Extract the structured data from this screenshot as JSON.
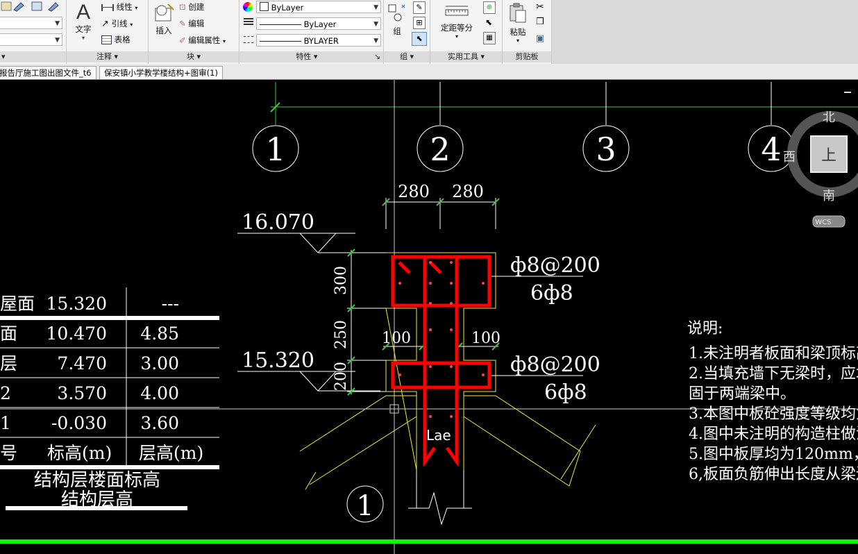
{
  "ribbon": {
    "annotation_panel": {
      "title": "注释",
      "text_btn": "文字",
      "linear_btn": "线性",
      "leader_btn": "引线",
      "table_btn": "表格"
    },
    "block_panel": {
      "title": "块",
      "insert_btn": "插入",
      "create_btn": "创建",
      "edit_btn": "编辑",
      "edit_attr_btn": "编辑属性"
    },
    "properties_panel": {
      "title": "特性",
      "color_value": "ByLayer",
      "linetype_value": "ByLayer",
      "lineweight_value": "BYLAYER"
    },
    "group_panel": {
      "title": "组",
      "group_btn": "组"
    },
    "utilities_panel": {
      "title": "实用工具",
      "measure_btn": "定距等分"
    },
    "clipboard_panel": {
      "title": "剪贴板",
      "paste_btn": "粘贴"
    }
  },
  "tabs": [
    {
      "label": "报告厅施工图出图文件_t6"
    },
    {
      "label": "保安镇小学教学楼结构+图审(1)"
    }
  ],
  "viewcube": {
    "north": "北",
    "south": "南",
    "west": "西",
    "face": "上",
    "wcs": "WCS"
  },
  "drawing": {
    "axes": [
      "1",
      "2",
      "3",
      "4"
    ],
    "dim_280_a": "280",
    "dim_280_b": "280",
    "dim_300": "300",
    "dim_250": "250",
    "dim_200": "200",
    "dim_100_a": "100",
    "dim_100_b": "100",
    "elev_top": "16.070",
    "elev_mid": "15.320",
    "rebar_top_stirrup": "ф8@200",
    "rebar_top_long": "6ф8",
    "rebar_bot_stirrup": "ф8@200",
    "rebar_bot_long": "6ф8",
    "lae": "Lae",
    "section_mark": "1",
    "floor_table": [
      {
        "name": "屋面",
        "elev": "15.320",
        "height": "---"
      },
      {
        "name": "面",
        "elev": "10.470",
        "height": "4.85"
      },
      {
        "name": "层",
        "elev": "7.470",
        "height": "3.00"
      },
      {
        "name": "2",
        "elev": "3.570",
        "height": "4.00"
      },
      {
        "name": "1",
        "elev": "-0.030",
        "height": "3.60"
      },
      {
        "name": "号",
        "elev": "标高(m)",
        "height": "层高(m)"
      }
    ],
    "table_caption_1": "结构层楼面标高",
    "table_caption_2": "结构层高",
    "notes_title": "说明:",
    "notes": [
      "1.未注明者板面和梁顶标高为",
      "2.当填充墙下无梁时，应增设",
      "固于两端梁中。",
      "3.本图中板砼强度等级均为C2",
      "4.图中未注明的构造柱做法详",
      "5.图中板厚均为120mm，",
      "6,板面负筋伸出长度从梁边算"
    ]
  }
}
